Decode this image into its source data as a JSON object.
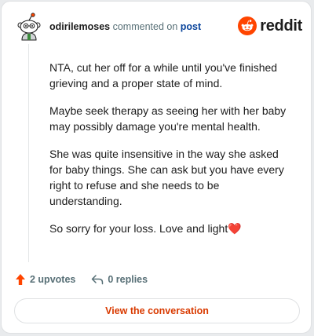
{
  "header": {
    "username": "odirilemoses",
    "action_text": "commented on",
    "post_link": "post",
    "brand": "reddit"
  },
  "comment": {
    "paragraphs": [
      "NTA, cut her off for a while until you've finished grieving and a proper state of mind.",
      "Maybe seek therapy as seeing her with her baby may possibly damage you're mental health.",
      "She was quite insensitive in the way she asked for baby things. She can ask but you have every right to refuse and she needs to be understanding.",
      "So sorry for your loss. Love and light❤️"
    ]
  },
  "actions": {
    "upvotes": "2 upvotes",
    "replies": "0 replies"
  },
  "cta": {
    "label": "View the conversation"
  },
  "icons": {
    "avatar": "snoo-avatar-icon",
    "logo": "reddit-logo-icon",
    "upvote": "upvote-arrow-icon",
    "reply": "reply-arrow-icon"
  },
  "colors": {
    "brand": "#ff4500",
    "link": "#0a449b",
    "cta": "#d93a00",
    "muted": "#576f76"
  }
}
